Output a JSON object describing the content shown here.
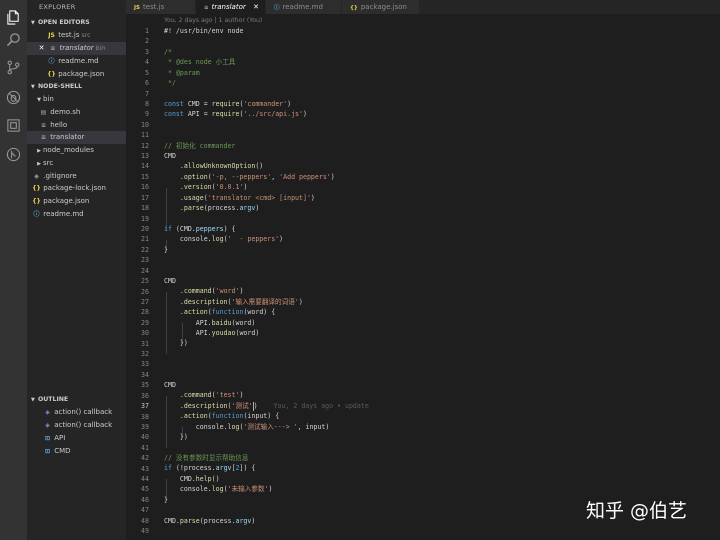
{
  "explorer": {
    "title": "EXPLORER",
    "open_editors": {
      "heading": "OPEN EDITORS",
      "items": [
        {
          "icon": "JS",
          "name": "test.js",
          "sub": "src"
        },
        {
          "icon": "≡",
          "name": "translator",
          "sub": "bin",
          "close": "✕"
        },
        {
          "icon": "ⓘ",
          "name": "readme.md"
        },
        {
          "icon": "{}",
          "name": "package.json"
        }
      ]
    },
    "project": {
      "heading": "NODE-SHELL",
      "items": [
        {
          "name": "bin"
        },
        {
          "name": "demo.sh"
        },
        {
          "name": "hello"
        },
        {
          "name": "translator"
        },
        {
          "name": "node_modules"
        },
        {
          "name": "src"
        },
        {
          "name": ".gitignore"
        },
        {
          "name": "package-lock.json"
        },
        {
          "name": "package.json"
        },
        {
          "name": "readme.md"
        }
      ]
    },
    "outline": {
      "heading": "OUTLINE",
      "items": [
        {
          "name": "action() callback"
        },
        {
          "name": "action() callback"
        },
        {
          "name": "API"
        },
        {
          "name": "CMD"
        }
      ]
    }
  },
  "tabs": [
    {
      "icon": "JS",
      "label": "test.js"
    },
    {
      "icon": "≡",
      "label": "translator",
      "close": "✕"
    },
    {
      "icon": "ⓘ",
      "label": "readme.md"
    },
    {
      "icon": "{}",
      "label": "package.json"
    }
  ],
  "editor": {
    "blame_header": "You, 2 days ago | 1 author (You)",
    "inline_blame": "You, 2 days ago • update",
    "current_line": 37,
    "line_numbers": [
      "1",
      "2",
      "3",
      "4",
      "5",
      "6",
      "7",
      "8",
      "9",
      "10",
      "11",
      "12",
      "13",
      "14",
      "15",
      "16",
      "17",
      "18",
      "19",
      "20",
      "21",
      "22",
      "23",
      "24",
      "25",
      "26",
      "27",
      "28",
      "29",
      "30",
      "31",
      "32",
      "33",
      "34",
      "35",
      "36",
      "37",
      "38",
      "39",
      "40",
      "41",
      "42",
      "43",
      "44",
      "45",
      "46",
      "47",
      "48",
      "49"
    ],
    "tokens": {
      "l1": "#! /usr/bin/env node",
      "l3": "/*",
      "l4": " * @des node 小工具",
      "l5": " * @param",
      "l6": " */",
      "l8a": "const",
      "l8b": " CMD = ",
      "l8c": "require",
      "l8d": "(",
      "l8e": "'commander'",
      "l8f": ")",
      "l9a": "const",
      "l9b": " API = ",
      "l9c": "require",
      "l9d": "(",
      "l9e": "'../src/api.js'",
      "l9f": ")",
      "l12": "// 初始化 commander",
      "l13": "CMD",
      "l14a": "    .",
      "l14b": "allowUnknownOption",
      "l14c": "()",
      "l15a": "    .",
      "l15b": "option",
      "l15c": "(",
      "l15d": "'-p, --peppers'",
      "l15e": ", ",
      "l15f": "'Add peppers'",
      "l15g": ")",
      "l16a": "    .",
      "l16b": "version",
      "l16c": "(",
      "l16d": "'0.0.1'",
      "l16e": ")",
      "l17a": "    .",
      "l17b": "usage",
      "l17c": "(",
      "l17d": "'translator <cmd> [input]'",
      "l17e": ")",
      "l18a": "    .",
      "l18b": "parse",
      "l18c": "(process.",
      "l18d": "argv",
      "l18e": ")",
      "l20a": "if",
      "l20b": " (CMD.",
      "l20c": "peppers",
      "l20d": ") {",
      "l21a": "    console.",
      "l21b": "log",
      "l21c": "(",
      "l21d": "'  - peppers'",
      "l21e": ")",
      "l22": "}",
      "l25": "CMD",
      "l26a": "    .",
      "l26b": "command",
      "l26c": "(",
      "l26d": "'word'",
      "l26e": ")",
      "l27a": "    .",
      "l27b": "description",
      "l27c": "(",
      "l27d": "'输入需要翻译的词语'",
      "l27e": ")",
      "l28a": "    .",
      "l28b": "action",
      "l28c": "(",
      "l28d": "function",
      "l28e": "(word) {",
      "l29a": "        API.",
      "l29b": "baidu",
      "l29c": "(word)",
      "l30a": "        API.",
      "l30b": "youdao",
      "l30c": "(word)",
      "l31": "    })",
      "l35": "CMD",
      "l36a": "    .",
      "l36b": "command",
      "l36c": "(",
      "l36d": "'test'",
      "l36e": ")",
      "l37a": "    .",
      "l37b": "description",
      "l37c": "(",
      "l37d": "'测试'",
      "l37e": ")",
      "l38a": "    .",
      "l38b": "action",
      "l38c": "(",
      "l38d": "function",
      "l38e": "(input) {",
      "l39a": "        console.",
      "l39b": "log",
      "l39c": "(",
      "l39d": "'测试输入---> '",
      "l39e": ", input)",
      "l40": "    })",
      "l42": "// 没有参数时显示帮助信息",
      "l43a": "if",
      "l43b": " (!process.",
      "l43c": "argv",
      "l43d": "[",
      "l43e": "2",
      "l43f": "]) {",
      "l44a": "    CMD.",
      "l44b": "help",
      "l44c": "()",
      "l45a": "    console.",
      "l45b": "log",
      "l45c": "(",
      "l45d": "'未输入参数'",
      "l45e": ")",
      "l46": "}",
      "l48a": "CMD.",
      "l48b": "parse",
      "l48c": "(process.",
      "l48d": "argv",
      "l48e": ")"
    }
  },
  "watermark": "知乎 @伯艺",
  "colors": {
    "background": "#1e1e1e",
    "sidebar": "#252526",
    "activity_bar": "#333333",
    "keyword": "#569cd6",
    "string": "#ce9178",
    "comment": "#6a9955",
    "function": "#dcdcaa",
    "property": "#9cdcfe"
  }
}
